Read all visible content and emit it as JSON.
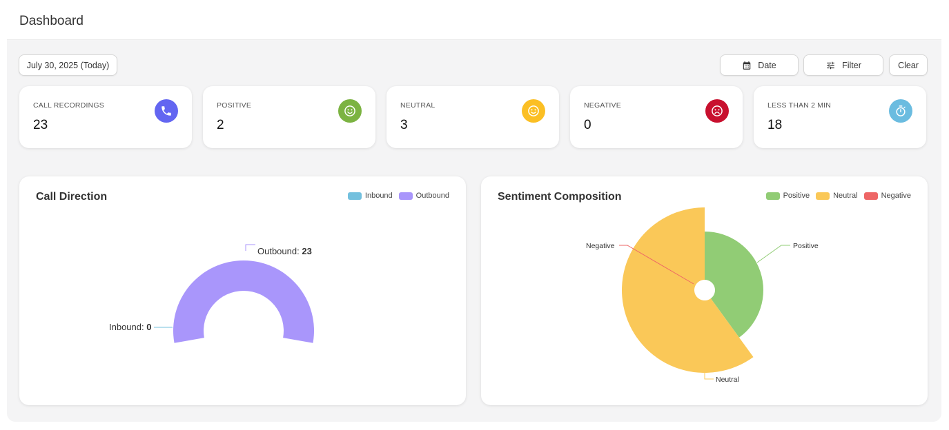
{
  "header": {
    "title": "Dashboard"
  },
  "toolbar": {
    "date_chip": "July 30, 2025 (Today)",
    "date_button": "Date",
    "filter_button": "Filter",
    "clear_button": "Clear",
    "date_icon": "calendar-icon",
    "filter_icon": "sliders-icon"
  },
  "stats": [
    {
      "label": "CALL RECORDINGS",
      "value": "23",
      "icon": "phone-icon",
      "color": "#6366f1"
    },
    {
      "label": "POSITIVE",
      "value": "2",
      "icon": "smile-icon",
      "color": "#7cb342"
    },
    {
      "label": "NEUTRAL",
      "value": "3",
      "icon": "neutral-face-icon",
      "color": "#fbbf24"
    },
    {
      "label": "NEGATIVE",
      "value": "0",
      "icon": "frown-icon",
      "color": "#c8102e"
    },
    {
      "label": "LESS THAN 2 MIN",
      "value": "18",
      "icon": "stopwatch-icon",
      "color": "#6bbce0"
    }
  ],
  "chart_data": [
    {
      "type": "pie",
      "subtype": "half-donut",
      "title": "Call Direction",
      "categories": [
        "Inbound",
        "Outbound"
      ],
      "values": [
        0,
        23
      ],
      "colors": [
        "#73c0de",
        "#a996fb"
      ],
      "legend": [
        "Inbound",
        "Outbound"
      ],
      "legend_position": "top-right",
      "labels": [
        {
          "name": "Inbound",
          "sep": ": ",
          "value": "0"
        },
        {
          "name": "Outbound",
          "sep": ": ",
          "value": "23"
        }
      ]
    },
    {
      "type": "pie",
      "subtype": "nightingale-rose",
      "title": "Sentiment Composition",
      "categories": [
        "Positive",
        "Neutral",
        "Negative"
      ],
      "values": [
        2,
        3,
        0
      ],
      "colors": [
        "#91cc75",
        "#fac858",
        "#ee6666"
      ],
      "legend": [
        "Positive",
        "Neutral",
        "Negative"
      ],
      "legend_position": "top-right",
      "labels": [
        "Positive",
        "Neutral",
        "Negative"
      ]
    }
  ]
}
